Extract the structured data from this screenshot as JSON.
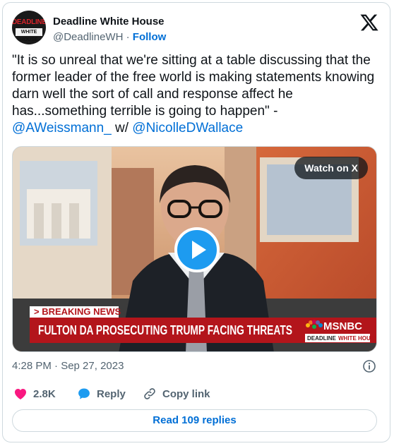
{
  "account": {
    "name": "Deadline White House",
    "handle": "@DeadlineWH",
    "separator": " · ",
    "follow_label": "Follow",
    "avatar_line1": "DEADLINE",
    "avatar_line2": "WHITE HOUSE"
  },
  "tweet": {
    "text": "\"It is so unreal that we're sitting at a table discussing that the former leader of the free world is making statements knowing darn well the sort of call and response affect he has...something terrible is going to happen\" - ",
    "mention1": "@AWeissmann_",
    "with_text": " w/ ",
    "mention2": "@NicolleDWallace"
  },
  "media": {
    "watch_label": "Watch on X",
    "breaking_label": "> BREAKING NEWS",
    "headline": "FULTON DA PROSECUTING TRUMP FACING THREATS",
    "network": "MSNBC",
    "show_badge_left": "DEADLINE",
    "show_badge_right": "WHITE HOUSE"
  },
  "meta": {
    "timestamp": "4:28 PM · Sep 27, 2023"
  },
  "actions": {
    "like_count": "2.8K",
    "reply_label": "Reply",
    "copy_label": "Copy link",
    "read_replies": "Read 109 replies"
  },
  "colors": {
    "link_blue": "#006fd6",
    "play_blue": "#1d9bf0",
    "like_pink": "#f91880",
    "muted_gray": "#536471",
    "border": "#cfd9de",
    "news_red": "#b3151b"
  },
  "icons": [
    "x-logo-icon",
    "play-icon",
    "info-icon",
    "heart-icon",
    "reply-icon",
    "link-icon",
    "peacock-icon"
  ]
}
